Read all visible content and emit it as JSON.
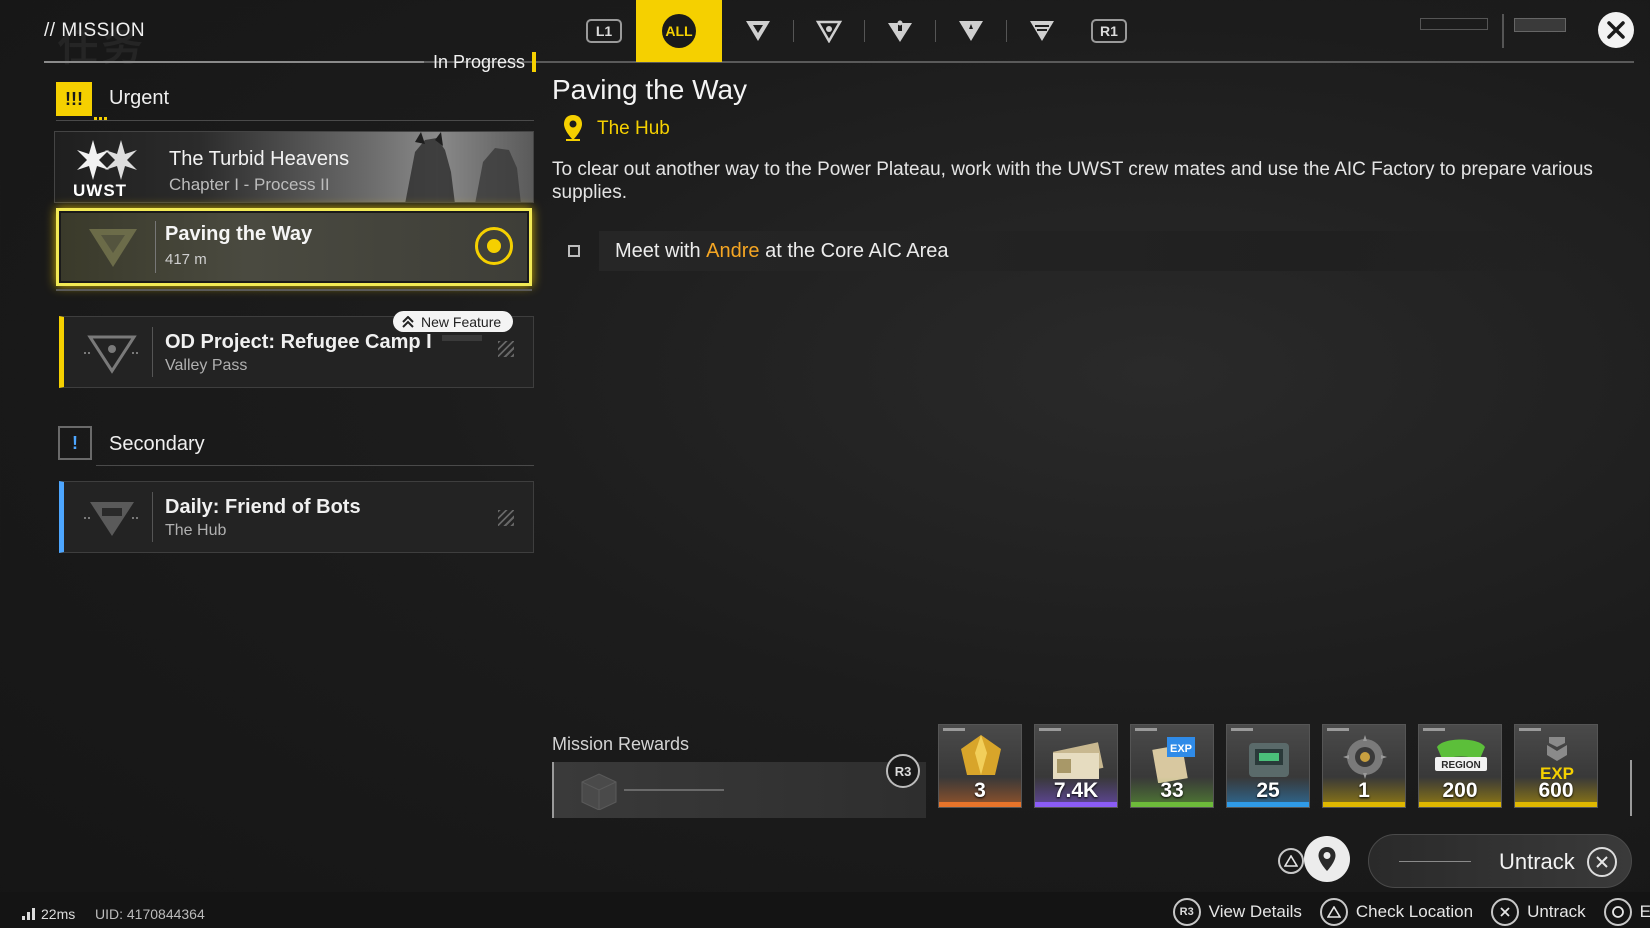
{
  "header": {
    "title": "// MISSION",
    "watermark": "任务",
    "section_status": "In Progress",
    "filters": {
      "left_key": "L1",
      "all_label": "ALL",
      "right_key": "R1",
      "icons": [
        "mission-type-1-icon",
        "mission-type-2-icon",
        "mission-type-3-icon",
        "mission-type-4-icon",
        "mission-type-5-icon"
      ]
    }
  },
  "sidebar": {
    "urgent": {
      "label": "Urgent",
      "story": {
        "title": "The Turbid Heavens",
        "subtitle": "Chapter I - Process II",
        "logo_text": "UWST"
      },
      "items": [
        {
          "title": "Paving the Way",
          "subtitle": "417 m",
          "selected": true,
          "tracked": true
        },
        {
          "title": "OD Project: Refugee Camp I",
          "subtitle": "Valley Pass",
          "badge": "New Feature"
        }
      ]
    },
    "secondary": {
      "label": "Secondary",
      "items": [
        {
          "title": "Daily: Friend of Bots",
          "subtitle": "The Hub"
        }
      ]
    }
  },
  "detail": {
    "title": "Paving the Way",
    "location": "The Hub",
    "description": "To clear out another way to the Power Plateau, work with the UWST crew mates and use the AIC Factory to prepare various supplies.",
    "objective": {
      "prefix": "Meet with ",
      "highlight": "Andre",
      "suffix": " at the Core AIC Area"
    }
  },
  "rewards": {
    "label": "Mission Rewards",
    "key": "R3",
    "items": [
      {
        "qty": "3",
        "icon": "gold-crystal-icon",
        "tier_color": "#e8742a"
      },
      {
        "qty": "7.4K",
        "icon": "currency-bills-icon",
        "tier_color": "#8b5cf6"
      },
      {
        "qty": "33",
        "icon": "exp-record-icon",
        "tier_color": "#6dbb3a"
      },
      {
        "qty": "25",
        "icon": "device-kit-icon",
        "tier_color": "#2f9be8"
      },
      {
        "qty": "1",
        "icon": "gear-core-icon",
        "tier_color": "#e0b800"
      },
      {
        "qty": "200",
        "icon": "region-badge-icon",
        "text": "REGION",
        "tier_color": "#e0b800"
      },
      {
        "qty": "600",
        "icon": "exp-badge-icon",
        "text": "EXP",
        "tier_color": "#e0b800"
      }
    ]
  },
  "actions": {
    "untrack_label": "Untrack"
  },
  "footer": {
    "ping": "22ms",
    "uid": "UID: 4170844364",
    "hints": [
      {
        "key": "R3",
        "label": "View Details"
      },
      {
        "key": "triangle",
        "label": "Check Location"
      },
      {
        "key": "cross",
        "label": "Untrack"
      },
      {
        "key": "circle",
        "label": "Exit"
      }
    ]
  },
  "colors": {
    "accent": "#f5d000",
    "secondary_accent": "#4da6ff",
    "highlight_text": "#f5a623"
  }
}
